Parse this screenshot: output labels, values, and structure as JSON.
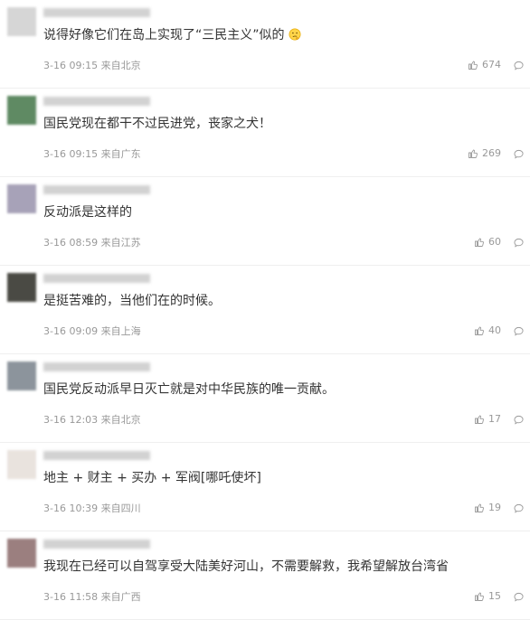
{
  "comments": [
    {
      "text": "说得好像它们在岛上实现了“三民主义”似的",
      "emoji": "thinking-face-icon",
      "time": "3-16 09:15 来自北京",
      "likes": "674",
      "avatar_color": "#d6d6d6",
      "username_bar_width_fraction": 0.2
    },
    {
      "text": "国民党现在都干不过民进党，丧家之犬！",
      "time": "3-16 09:15 来自广东",
      "likes": "269",
      "avatar_color": "#5f8a63"
    },
    {
      "text": "反动派是这样的",
      "time": "3-16 08:59 来自江苏",
      "likes": "60",
      "avatar_color": "#a7a2b8"
    },
    {
      "text": "是挺苦难的，当他们在的时候。",
      "time": "3-16 09:09 来自上海",
      "likes": "40",
      "avatar_color": "#4a4a44"
    },
    {
      "text": "国民党反动派早日灭亡就是对中华民族的唯一贡献。",
      "time": "3-16 12:03 来自北京",
      "likes": "17",
      "avatar_color": "#8c949c"
    },
    {
      "text": "地主 + 财主 + 买办 + 军阀[哪吒使坏]",
      "time": "3-16 10:39 来自四川",
      "likes": "19",
      "avatar_color": "#e9e3de"
    },
    {
      "text": "我现在已经可以自驾享受大陆美好河山，不需要解救，我希望解放台湾省",
      "time": "3-16 11:58 来自广西",
      "likes": "15",
      "avatar_color": "#9b7f7f"
    }
  ],
  "icons": {
    "like": "thumbs-up-icon",
    "reply": "comment-bubble-icon"
  },
  "colors": {
    "text": "#333333",
    "meta": "#999999",
    "divider": "#efefef"
  }
}
